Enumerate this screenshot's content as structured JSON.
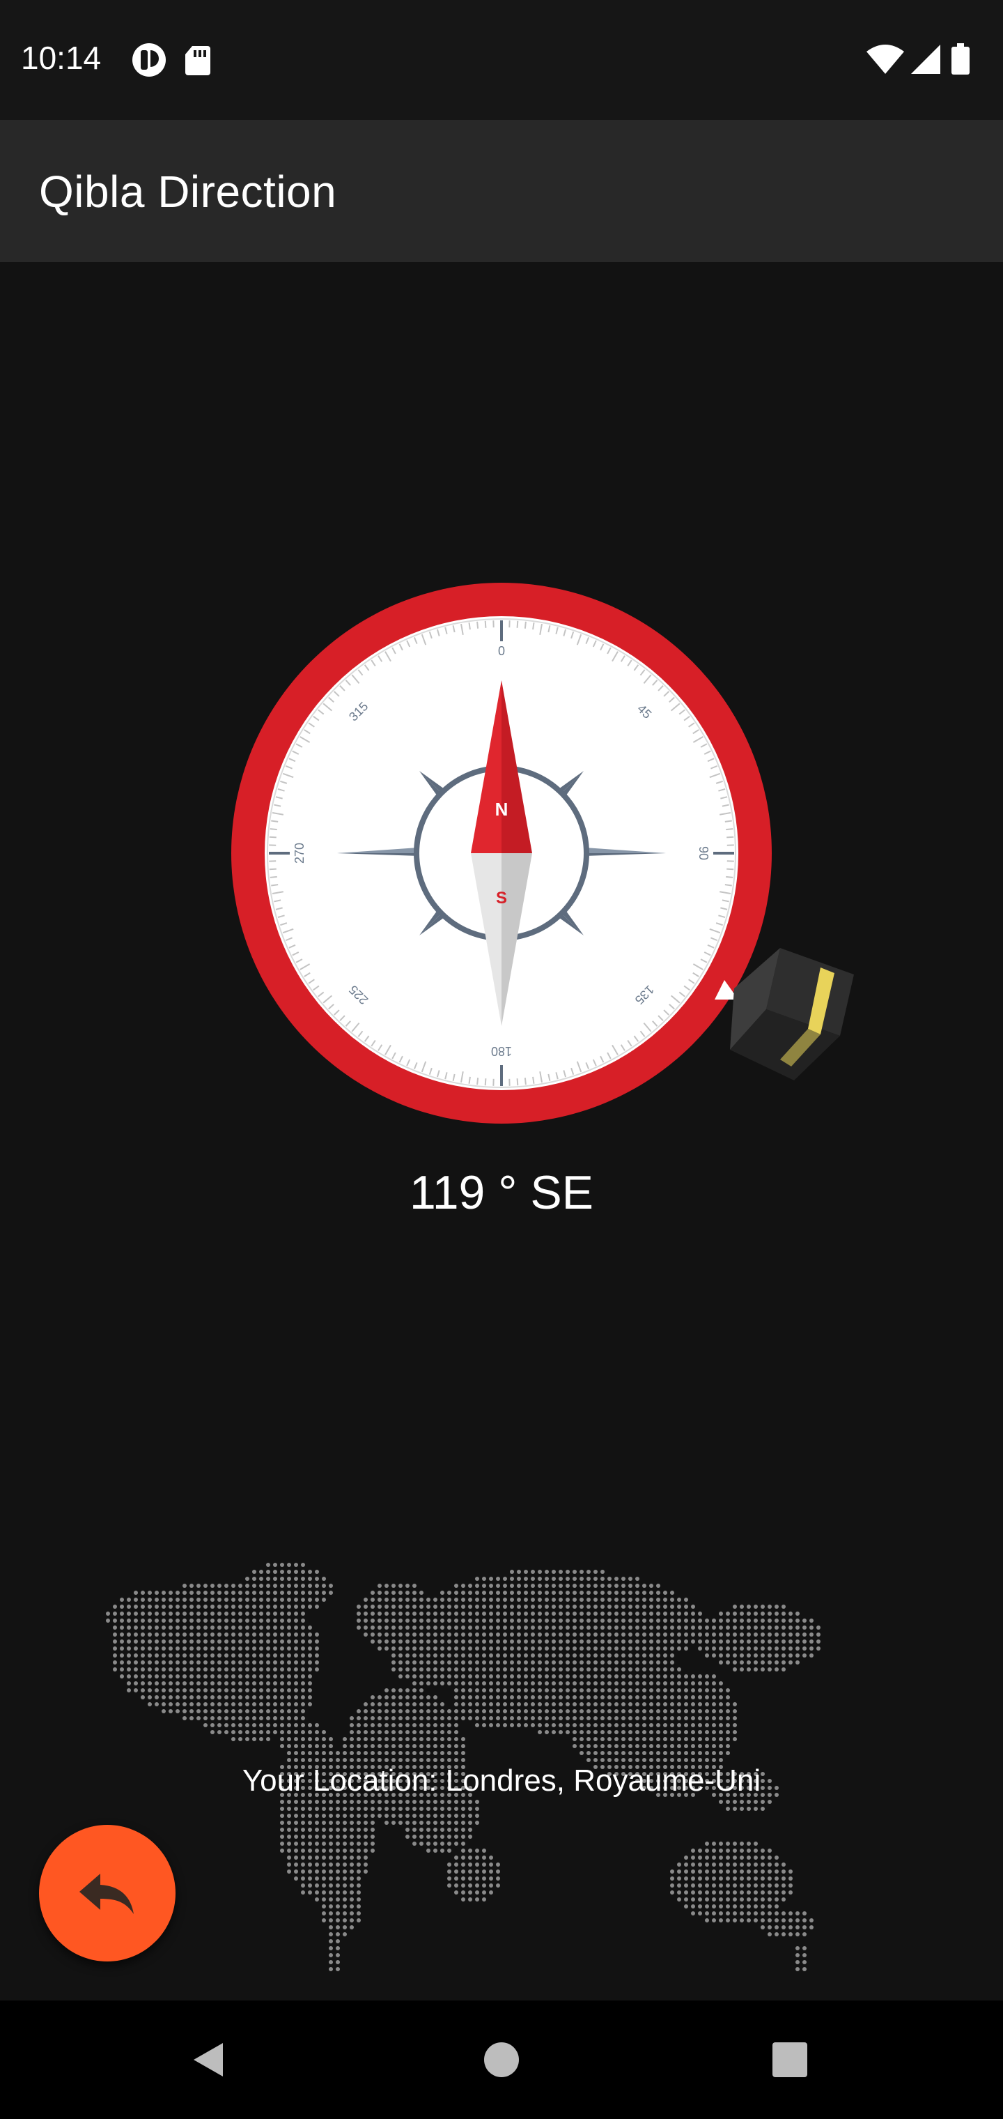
{
  "status_bar": {
    "time": "10:14",
    "left_icons": [
      "notification-app-icon",
      "sd-card-icon"
    ],
    "right_icons": [
      "wifi-icon",
      "cell-signal-icon",
      "battery-icon"
    ]
  },
  "app_bar": {
    "title": "Qibla Direction"
  },
  "compass": {
    "heading_text": "119 ° SE",
    "needle_north_label": "N",
    "needle_south_label": "S",
    "degree_labels": [
      "0",
      "45",
      "90",
      "135",
      "180",
      "225",
      "270",
      "315"
    ],
    "qibla_bearing_deg": 119,
    "ring_color": "#D71F27",
    "marker_icon": "kaaba-icon"
  },
  "location": {
    "text": "Your Location: Londres, Royaume-Uni"
  },
  "fab": {
    "icon": "reply-arrow-icon",
    "color": "#FF5722"
  },
  "nav_bar": {
    "buttons": [
      "back-icon",
      "home-icon",
      "recents-icon"
    ]
  }
}
